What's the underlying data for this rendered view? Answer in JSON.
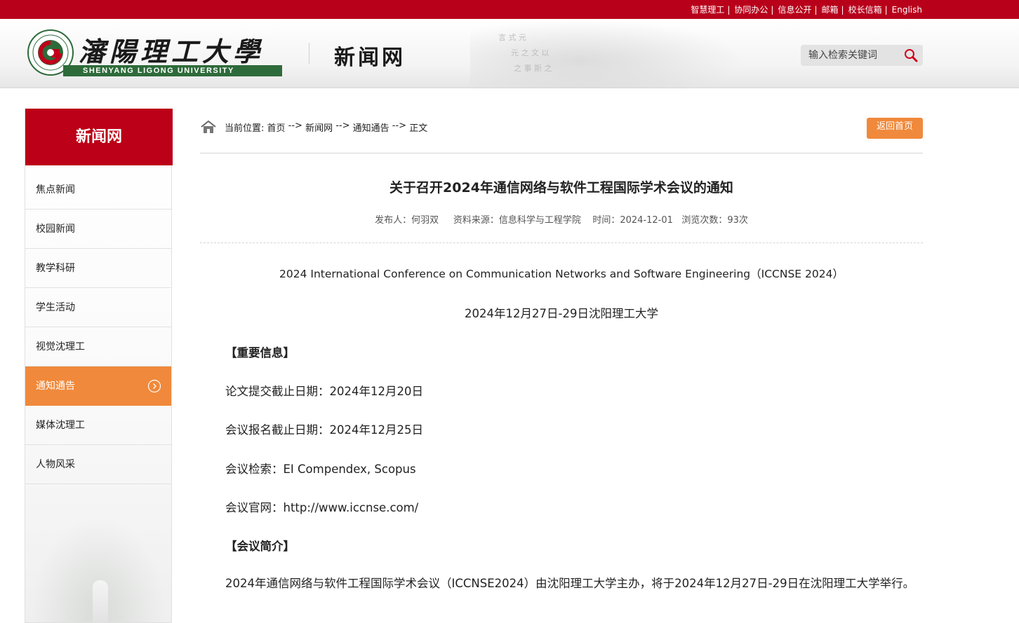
{
  "top_links": [
    "智慧理工",
    "协同办公",
    "信息公开",
    "邮箱",
    "校长信箱",
    "English"
  ],
  "header": {
    "logo_cn": "瀋陽理工大學",
    "logo_en": "SHENYANG LIGONG UNIVERSITY",
    "site_name": "新闻网",
    "search_placeholder": "输入检索关键词"
  },
  "sidebar": {
    "title": "新闻网",
    "items": [
      {
        "label": "焦点新闻"
      },
      {
        "label": "校园新闻"
      },
      {
        "label": "教学科研"
      },
      {
        "label": "学生活动"
      },
      {
        "label": "视觉沈理工"
      },
      {
        "label": "通知通告",
        "active": true
      },
      {
        "label": "媒体沈理工"
      },
      {
        "label": "人物风采"
      }
    ]
  },
  "breadcrumb": {
    "prefix": "当前位置: ",
    "items": [
      "首页",
      "新闻网",
      "通知通告",
      "正文"
    ],
    "separator": " --> "
  },
  "back_button": "返回首页",
  "article": {
    "title": "关于召开2024年通信网络与软件工程国际学术会议的通知",
    "meta": {
      "author": "发布人：何羽双",
      "source": "资料来源：信息科学与工程学院",
      "time": "时间：2024-12-01",
      "views": "浏览次数：93次"
    },
    "conf_name_en": "2024 International Conference on Communication Networks and Software Engineering（ICCNSE 2024）",
    "date_place": "2024年12月27日-29日沈阳理工大学",
    "section_important": "【重要信息】",
    "paper_deadline": "论文提交截止日期：2024年12月20日",
    "register_deadline": "会议报名截止日期：2024年12月25日",
    "indexing": "会议检索：EI Compendex, Scopus",
    "website": "会议官网：http://www.iccnse.com/",
    "section_intro": "【会议简介】",
    "intro": "2024年通信网络与软件工程国际学术会议（ICCNSE2024）由沈阳理工大学主办，将于2024年12月27日-29日在沈阳理工大学举行。"
  },
  "colors": {
    "brand_red": "#b8001b",
    "accent_orange": "#f0893b",
    "logo_green": "#2e6b3a"
  }
}
